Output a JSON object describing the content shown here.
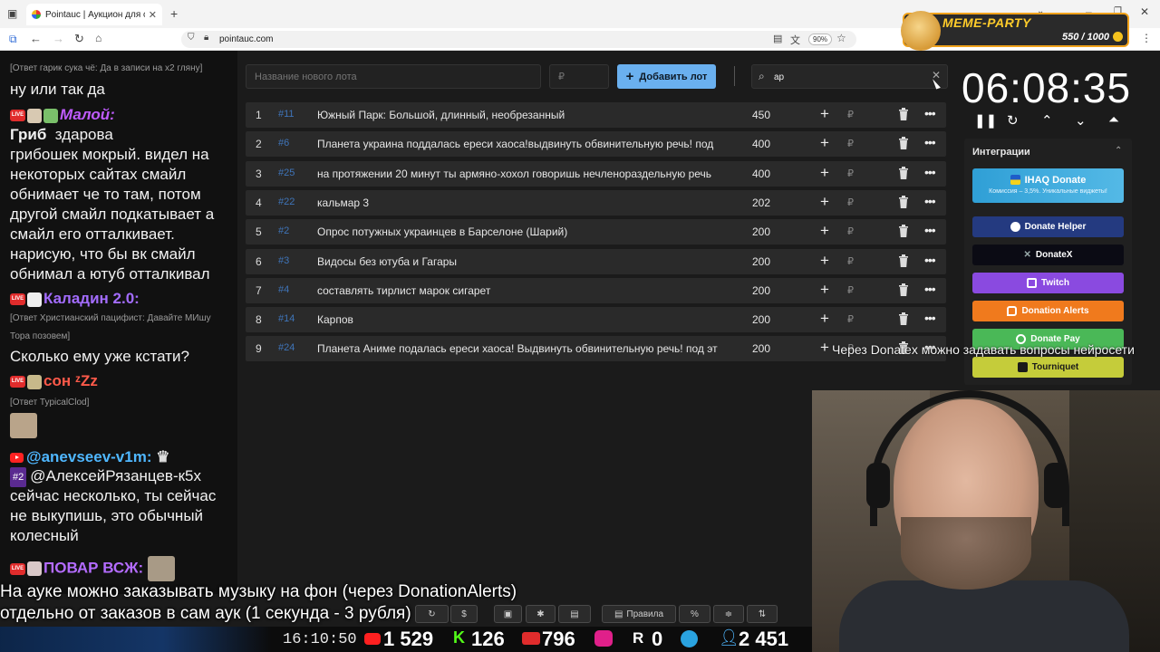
{
  "browser": {
    "tab_title": "Pointauc | Аукцион для стрима",
    "url": "pointauc.com",
    "zoom": "90%"
  },
  "meme_party": {
    "title": "MEME-PARTY",
    "score": "550 / 1000"
  },
  "chat": {
    "messages": [
      {
        "reply": "[Ответ гарик сука чё: Да в записи на х2 гляну]",
        "text": "ну или так да"
      },
      {
        "user": "Малой:",
        "user_color": "#c05cff",
        "text": [
          "Гриб",
          "грибошек мокрый. видел на",
          "некоторых сайтах смайл",
          "обнимает че то там, потом",
          "другой смайл подкатывает а",
          "смайл его отталкивает.",
          "нарисую, что бы вк смайл",
          "обнимал а ютуб отталкивал"
        ],
        "header_extra": "здарова"
      },
      {
        "user": "Каладин 2.0:",
        "user_color": "#a36cff",
        "reply": [
          "[Ответ Христианский пацифист: Давайте МИшу",
          "Тора позовем]"
        ],
        "text": "Сколько ему уже кстати?"
      },
      {
        "user": "сон ᶻZz",
        "user_color": "#ff5a4a",
        "reply": "[Ответ TypicalClod]"
      },
      {
        "user": "@anevseev-v1m:",
        "user_color": "#4fb7ff",
        "badge": "#2",
        "text": [
          "@АлексейРязанцев-к5х",
          "сейчас несколько, ты сейчас",
          "не выкупишь, это обычный",
          "колесный"
        ]
      },
      {
        "user": "ПОВАР ВСЖ:",
        "user_color": "#b46cff"
      }
    ]
  },
  "lot_form": {
    "name_placeholder": "Название нового лота",
    "amount_placeholder": "₽",
    "add_label": "Добавить лот"
  },
  "search": {
    "value": "ар"
  },
  "lots": [
    {
      "num": "1",
      "id": "#11",
      "name": "Южный Парк: Большой, длинный, необрезанный",
      "amount": "450"
    },
    {
      "num": "2",
      "id": "#6",
      "name": "Планета украина поддалась ереси хаоса!выдвинуть обвинительную речь! под",
      "amount": "400"
    },
    {
      "num": "3",
      "id": "#25",
      "name": "на протяжении 20 минут ты армяно-хохол говоришь нечленораздельную речь",
      "amount": "400"
    },
    {
      "num": "4",
      "id": "#22",
      "name": "кальмар 3",
      "amount": "202"
    },
    {
      "num": "5",
      "id": "#2",
      "name": "Опрос потужных украинцев в Барселоне (Шарий)",
      "amount": "200"
    },
    {
      "num": "6",
      "id": "#3",
      "name": "Видосы без ютуба и Гагары",
      "amount": "200"
    },
    {
      "num": "7",
      "id": "#4",
      "name": "составлять тирлист марок сигарет",
      "amount": "200"
    },
    {
      "num": "8",
      "id": "#14",
      "name": "Карпов",
      "amount": "200"
    },
    {
      "num": "9",
      "id": "#24",
      "name": "Планета Аниме подалась ереси хаоса! Выдвинуть обвинительную речь! под эт",
      "amount": "200"
    }
  ],
  "timer": {
    "value": "06:08:35"
  },
  "integrations": {
    "title": "Интеграции",
    "items": [
      {
        "label": "IHAQ Donate",
        "sub": "Комиссия – 3,5%. Уникальные виджеты!",
        "color": "#3ea8d8"
      },
      {
        "label": "Donate Helper",
        "color": "#243a80"
      },
      {
        "label": "DonateX",
        "color": "#0b0b14"
      },
      {
        "label": "Twitch",
        "color": "#8a4ae0"
      },
      {
        "label": "Donation Alerts",
        "color": "#f07a1d"
      },
      {
        "label": "Donate Pay",
        "color": "#4ab857"
      },
      {
        "label": "Tourniquet",
        "color": "#c5cc3a"
      }
    ]
  },
  "overlay_text": "Через Donatex можно задавать вопросы нейросети",
  "subtitles": [
    "На ауке можно заказывать музыку на фон (через DonationAlerts)",
    "отдельно от заказов в сам аук (1 секунда - 3 рубля)"
  ],
  "toolbar": {
    "rules_label": "Правила"
  },
  "stats": {
    "time": "16:10:50",
    "youtube": "1 529",
    "kick": "126",
    "vk": "796",
    "rutube": "0",
    "total": "2 451"
  }
}
